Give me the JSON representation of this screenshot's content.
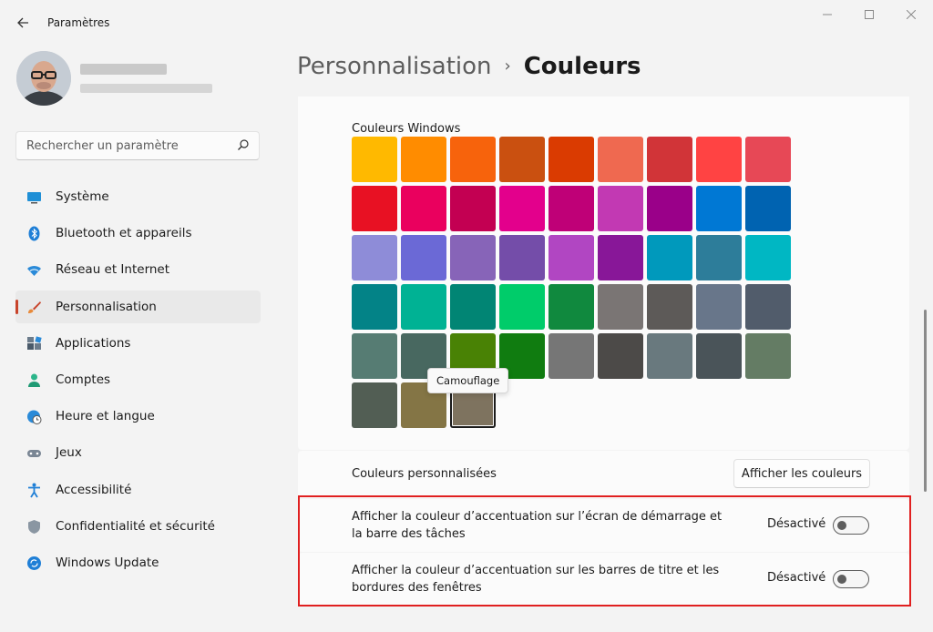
{
  "window": {
    "title": "Paramètres",
    "back_icon": "arrow-left-icon",
    "controls": [
      "minimize-icon",
      "maximize-icon",
      "close-icon"
    ]
  },
  "search": {
    "placeholder": "Rechercher un paramètre",
    "icon": "search-icon"
  },
  "sidebar": {
    "items": [
      {
        "label": "Système",
        "icon": "monitor-icon",
        "active": false
      },
      {
        "label": "Bluetooth et appareils",
        "icon": "bluetooth-icon",
        "active": false
      },
      {
        "label": "Réseau et Internet",
        "icon": "wifi-icon",
        "active": false
      },
      {
        "label": "Personnalisation",
        "icon": "brush-icon",
        "active": true
      },
      {
        "label": "Applications",
        "icon": "apps-icon",
        "active": false
      },
      {
        "label": "Comptes",
        "icon": "person-icon",
        "active": false
      },
      {
        "label": "Heure et langue",
        "icon": "globe-clock-icon",
        "active": false
      },
      {
        "label": "Jeux",
        "icon": "gamepad-icon",
        "active": false
      },
      {
        "label": "Accessibilité",
        "icon": "accessibility-icon",
        "active": false
      },
      {
        "label": "Confidentialité et sécurité",
        "icon": "shield-icon",
        "active": false
      },
      {
        "label": "Windows Update",
        "icon": "update-icon",
        "active": false
      }
    ]
  },
  "breadcrumb": {
    "parent": "Personnalisation",
    "separator": "›",
    "current": "Couleurs"
  },
  "windows_colors": {
    "title": "Couleurs Windows",
    "swatches": [
      "#FFB900",
      "#FF8C00",
      "#F7630C",
      "#CA5010",
      "#DA3B01",
      "#EF6950",
      "#D13438",
      "#FF4343",
      "#E74856",
      "#E81123",
      "#EA005E",
      "#C30052",
      "#E3008C",
      "#BF0077",
      "#C239B3",
      "#9A0089",
      "#0078D4",
      "#0063B1",
      "#8E8CD8",
      "#6B69D6",
      "#8764B8",
      "#744DA9",
      "#B146C2",
      "#881798",
      "#0099BC",
      "#2D7D9A",
      "#00B7C3",
      "#038387",
      "#00B294",
      "#018574",
      "#00CC6A",
      "#10893E",
      "#7A7574",
      "#5D5A58",
      "#68768A",
      "#515C6B",
      "#567C73",
      "#486860",
      "#498205",
      "#107C10",
      "#767676",
      "#4C4A48",
      "#69797E",
      "#4A5459",
      "#647C64",
      "#525E54",
      "#847545",
      "#7E735F"
    ],
    "selected_index": 47,
    "tooltip": "Camouflage"
  },
  "custom_colors": {
    "label": "Couleurs personnalisées",
    "button": "Afficher les couleurs"
  },
  "toggles": [
    {
      "line1": "Afficher la couleur d’accentuation sur l’écran de démarrage et",
      "line2": "la barre des tâches",
      "state": "Désactivé",
      "on": false
    },
    {
      "line1": "Afficher la couleur d’accentuation sur les barres de titre et les",
      "line2": "bordures des fenêtres",
      "state": "Désactivé",
      "on": false
    }
  ],
  "colors": {
    "accent_indicator": "#C8442B",
    "highlight_border": "#E02020"
  }
}
